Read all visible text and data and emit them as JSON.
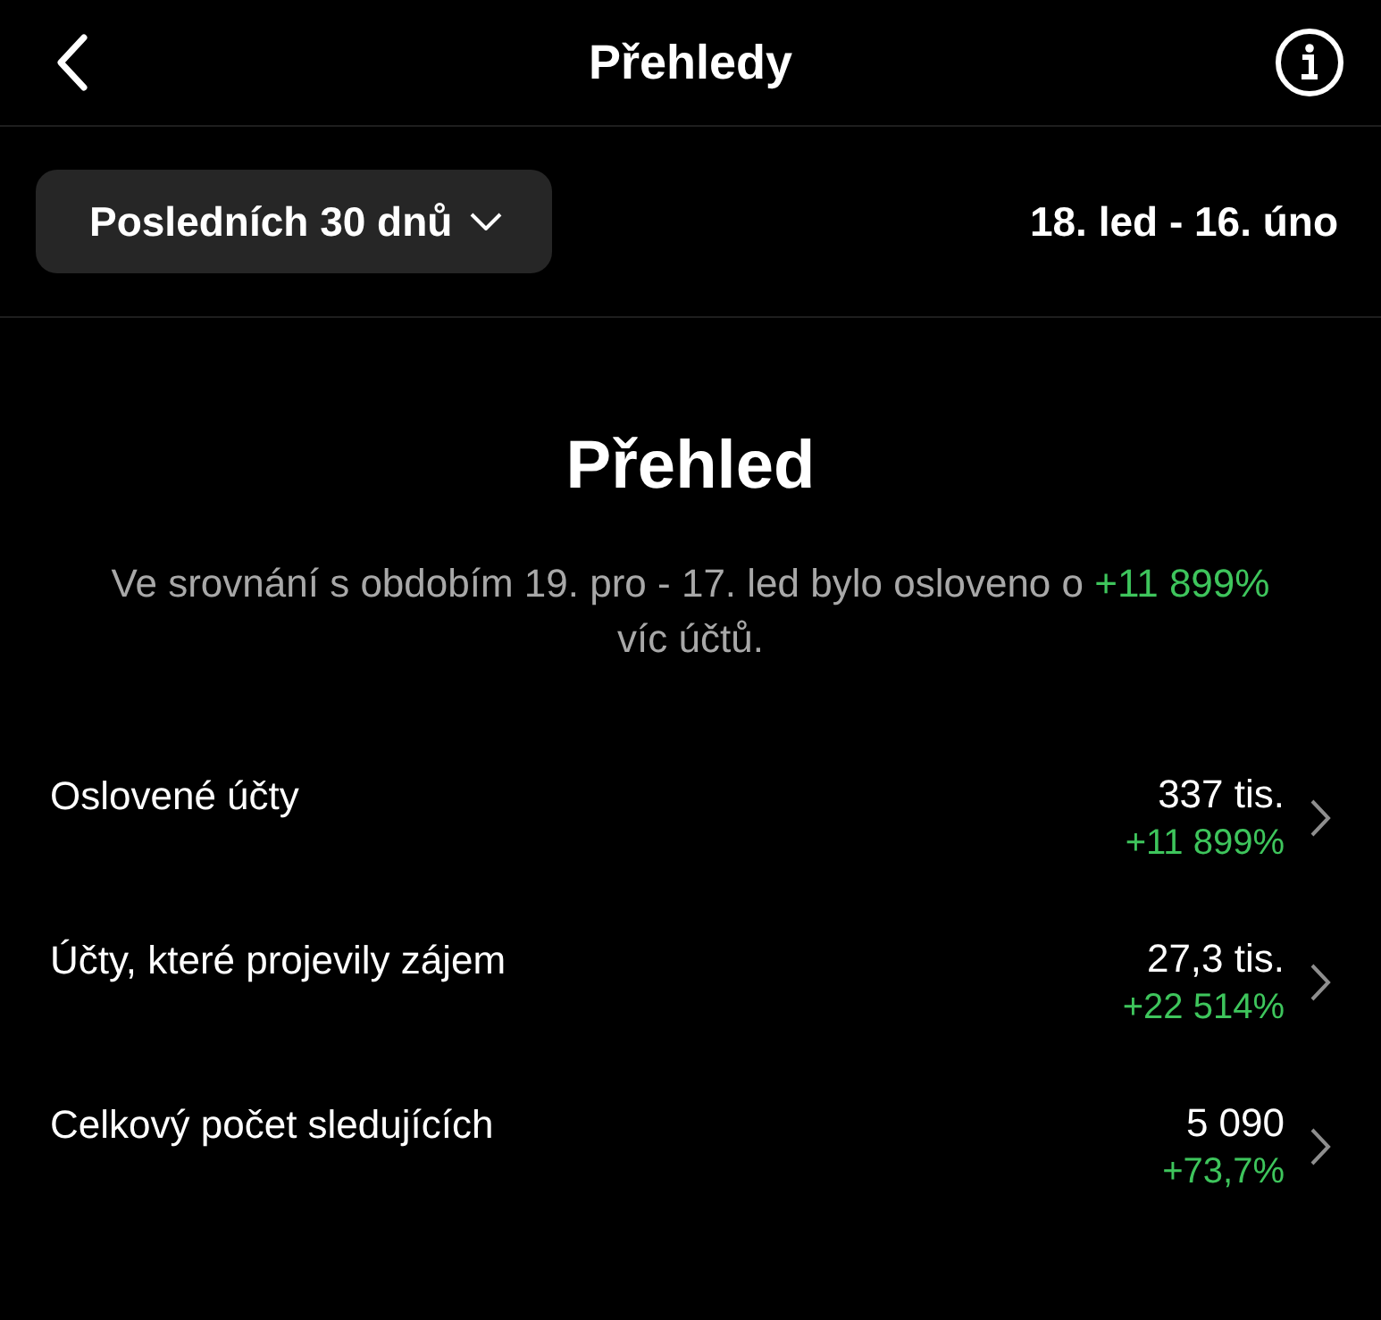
{
  "header": {
    "title": "Přehledy"
  },
  "filter": {
    "label": "Posledních 30 dnů",
    "date_range": "18. led - 16. úno"
  },
  "overview": {
    "title": "Přehled",
    "comparison_before": "Ve srovnání s obdobím 19. pro - 17. led bylo osloveno o",
    "comparison_highlight": "+11 899%",
    "comparison_after": "víc účtů."
  },
  "metrics": [
    {
      "label": "Oslovené účty",
      "value": "337 tis.",
      "change": "+11 899%"
    },
    {
      "label": "Účty, které projevily zájem",
      "value": "27,3 tis.",
      "change": "+22 514%"
    },
    {
      "label": "Celkový počet sledujících",
      "value": "5 090",
      "change": "+73,7%"
    }
  ]
}
